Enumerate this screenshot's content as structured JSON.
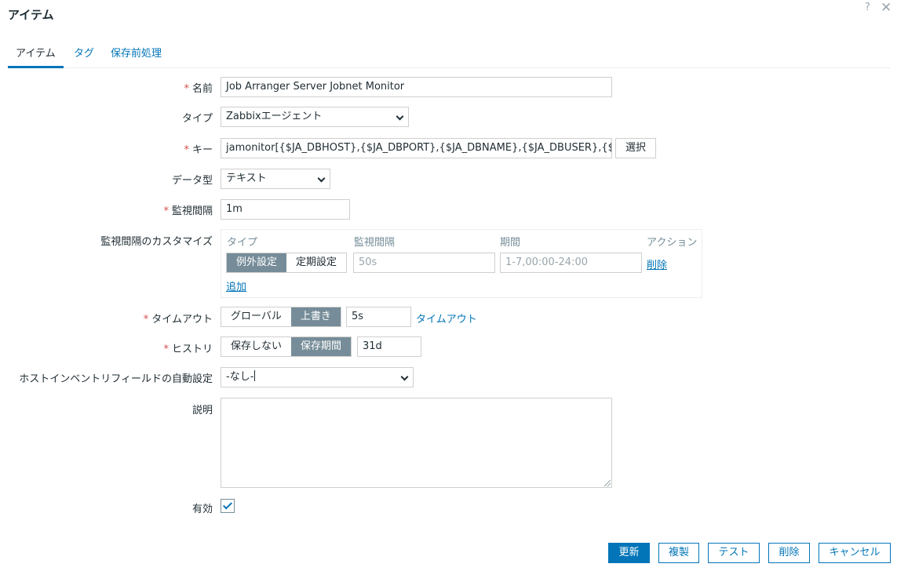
{
  "dialog": {
    "title": "アイテム",
    "help_glyph": "?",
    "close_glyph": "✕"
  },
  "tabs": [
    "アイテム",
    "タグ",
    "保存前処理"
  ],
  "form": {
    "name": {
      "label": "名前",
      "value": "Job Arranger Server Jobnet Monitor"
    },
    "type": {
      "label": "タイプ",
      "value": "Zabbixエージェント"
    },
    "key": {
      "label": "キー",
      "value": "jamonitor[{$JA_DBHOST},{$JA_DBPORT},{$JA_DBNAME},{$JA_DBUSER},{$JA_",
      "select_button": "選択"
    },
    "data_type": {
      "label": "データ型",
      "value": "テキスト"
    },
    "interval": {
      "label": "監視間隔",
      "value": "1m"
    },
    "custom_intervals": {
      "label": "監視間隔のカスタマイズ",
      "headers": {
        "type": "タイプ",
        "interval": "監視間隔",
        "period": "期間",
        "action": "アクション"
      },
      "row": {
        "type_options": [
          "例外設定",
          "定期設定"
        ],
        "interval_placeholder": "50s",
        "period_placeholder": "1-7,00:00-24:00",
        "remove_label": "削除"
      },
      "add_label": "追加"
    },
    "timeout": {
      "label": "タイムアウト",
      "options": [
        "グローバル",
        "上書き"
      ],
      "value": "5s",
      "link": "タイムアウト"
    },
    "history": {
      "label": "ヒストリ",
      "options": [
        "保存しない",
        "保存期間"
      ],
      "value": "31d"
    },
    "inventory": {
      "label": "ホストインベントリフィールドの自動設定",
      "value": "-なし-"
    },
    "description": {
      "label": "説明",
      "value": ""
    },
    "enabled": {
      "label": "有効",
      "checked": true
    }
  },
  "footer": {
    "update": "更新",
    "clone": "複製",
    "test": "テスト",
    "delete": "削除",
    "cancel": "キャンセル"
  },
  "colors": {
    "accent": "#0275b8",
    "required": "#d64e4e",
    "segment_active": "#768d99"
  }
}
